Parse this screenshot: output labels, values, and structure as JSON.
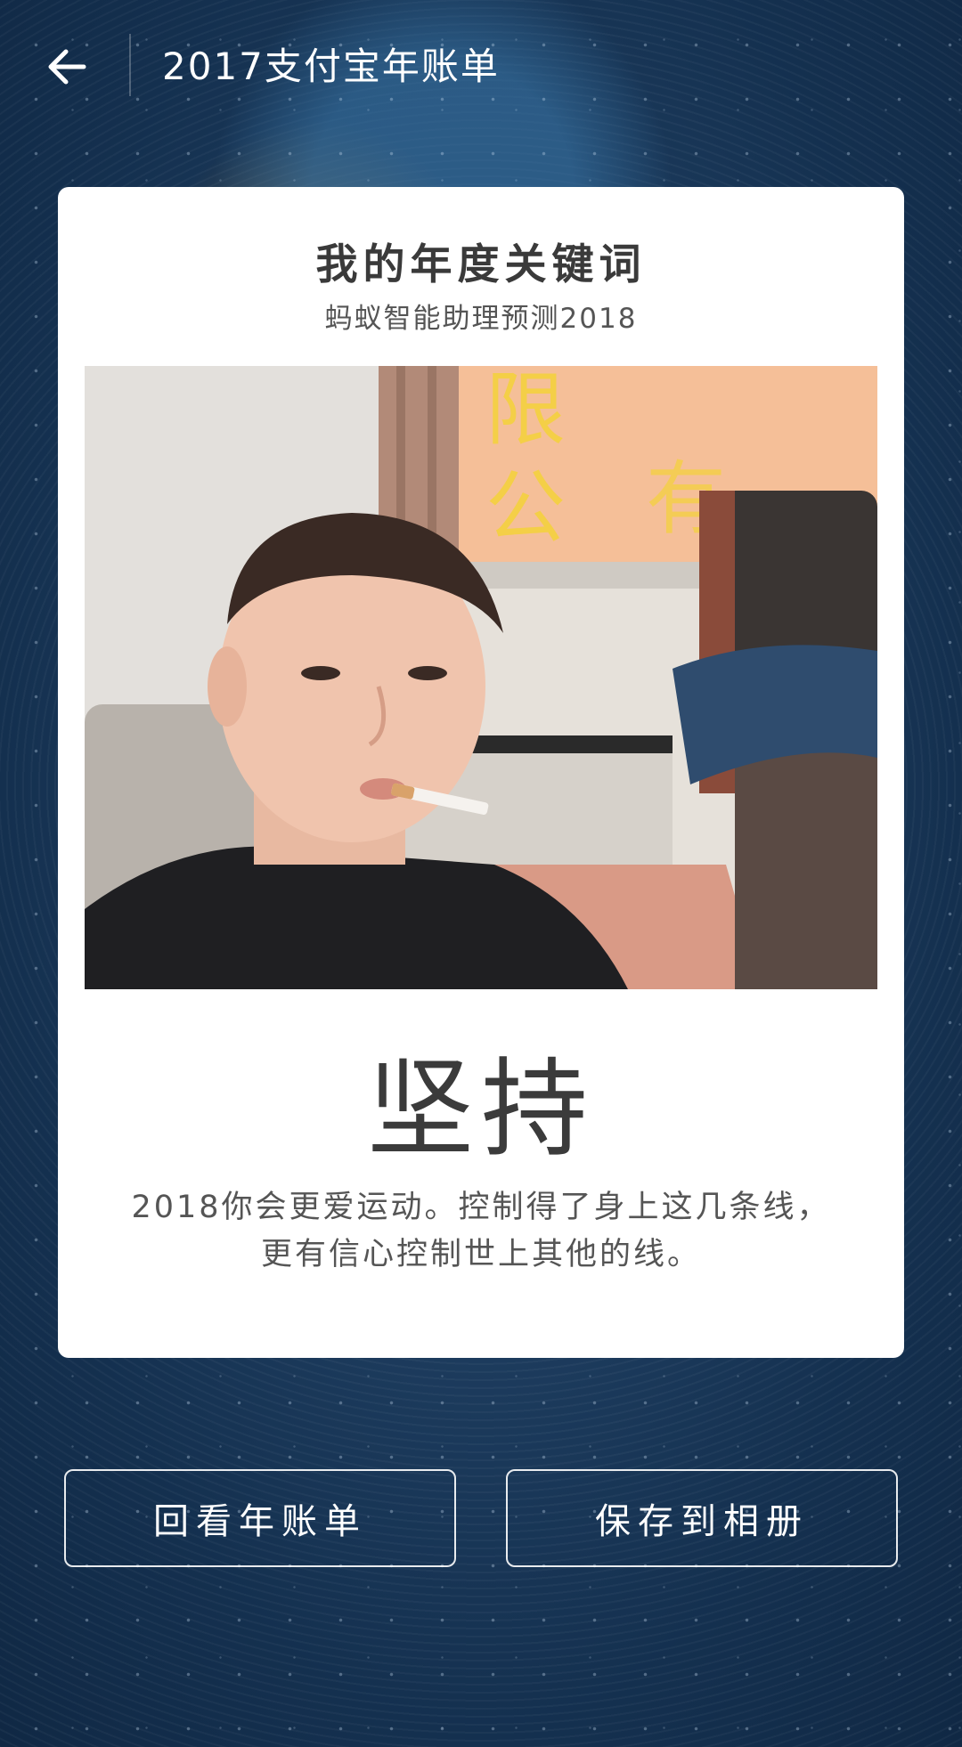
{
  "header": {
    "back_icon": "arrow-left-icon",
    "title": "2017支付宝年账单"
  },
  "card": {
    "title": "我的年度关键词",
    "subtitle": "蚂蚁智能助理预测2018",
    "photo_description_icon": "selfie-photo",
    "keyword": "坚持",
    "description": "2018你会更爱运动。控制得了身上这几条线，更有信心控制世上其他的线。"
  },
  "buttons": {
    "review_label": "回看年账单",
    "save_label": "保存到相册"
  },
  "colors": {
    "background": "#1d3c5e",
    "card": "#ffffff",
    "text_dark": "#3a3a3a"
  }
}
